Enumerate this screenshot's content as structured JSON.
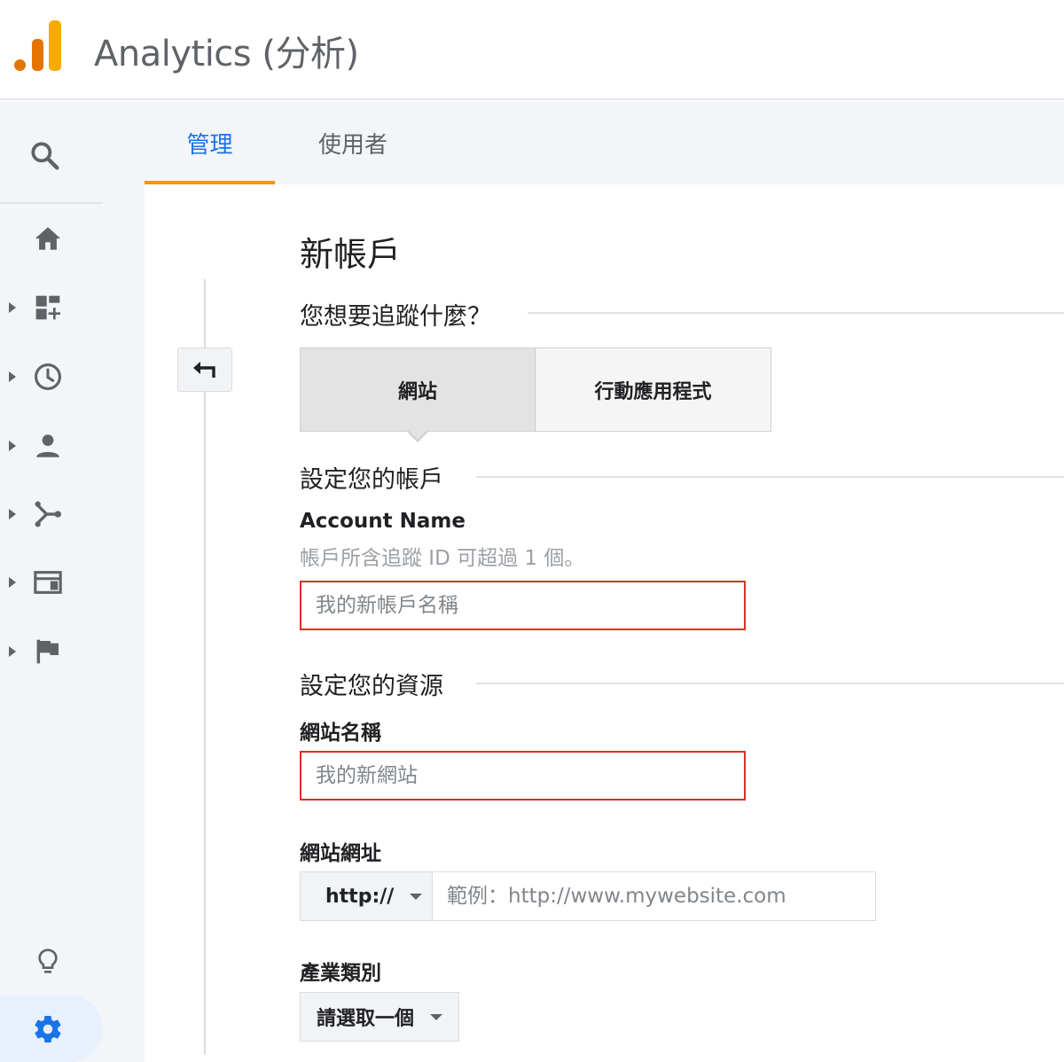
{
  "header": {
    "app_title": "Analytics (分析)"
  },
  "tabs": [
    {
      "label": "管理",
      "active": true
    },
    {
      "label": "使用者",
      "active": false
    }
  ],
  "sidebar": {
    "icons": [
      "search-icon",
      "home-icon",
      "customization-icon",
      "realtime-icon",
      "audience-icon",
      "acquisition-icon",
      "behavior-icon",
      "conversions-icon",
      "lightbulb-icon",
      "gear-icon"
    ],
    "active_item": "admin"
  },
  "form": {
    "page_title": "新帳戶",
    "track_question": "您想要追蹤什麼？",
    "track_options": [
      "網站",
      "行動應用程式"
    ],
    "selected_option": "網站",
    "account_section": "設定您的帳戶",
    "account_name_label": "Account Name",
    "account_hint": "帳戶所含追蹤 ID 可超過 1 個。",
    "account_name_placeholder": "我的新帳戶名稱",
    "property_section": "設定您的資源",
    "site_name_label": "網站名稱",
    "site_name_placeholder": "我的新網站",
    "site_url_label": "網站網址",
    "protocol_value": "http://",
    "site_url_placeholder": "範例：http://www.mywebsite.com",
    "industry_label": "產業類別",
    "industry_value": "請選取一個"
  },
  "colors": {
    "accent": "#1a73e8",
    "tab_underline": "#f29900",
    "error_border": "#d93025",
    "logo_dark": "#e37400",
    "logo_light": "#f9ab00"
  }
}
